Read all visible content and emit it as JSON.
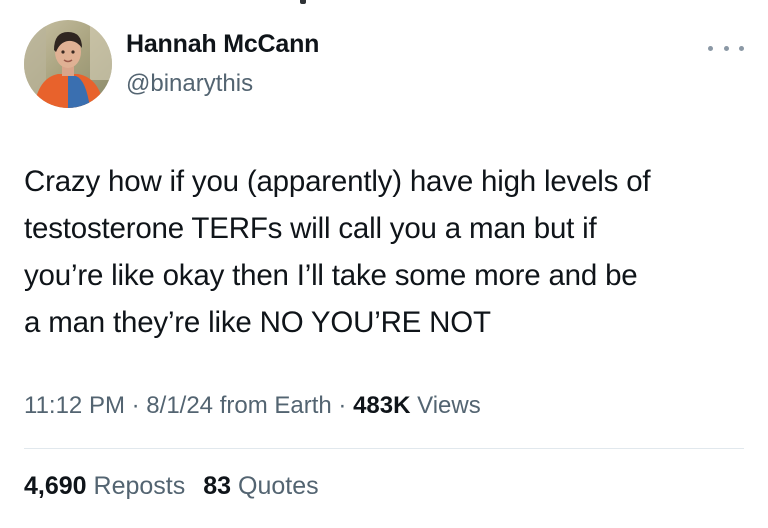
{
  "author": {
    "name": "Hannah McCann",
    "handle": "@binarythis",
    "avatar_icon": "profile-photo",
    "more_icon": "more-options-icon"
  },
  "tweet": {
    "text_lines": [
      "Crazy how if you (apparently) have high levels of",
      "testosterone TERFs will call you a man but if",
      "you’re like okay then I’ll take some more and be",
      "a man they’re like NO YOU’RE NOT"
    ]
  },
  "meta": {
    "time": "11:12 PM",
    "separator": "·",
    "date": "8/1/24",
    "source": "from Earth",
    "views_count": "483K",
    "views_label": "Views"
  },
  "stats": {
    "reposts_count": "4,690",
    "reposts_label": "Reposts",
    "quotes_count": "83",
    "quotes_label": "Quotes"
  },
  "colors": {
    "text_primary": "#0f1419",
    "text_secondary": "#536471",
    "divider": "#e1e8ed",
    "background": "#ffffff"
  }
}
